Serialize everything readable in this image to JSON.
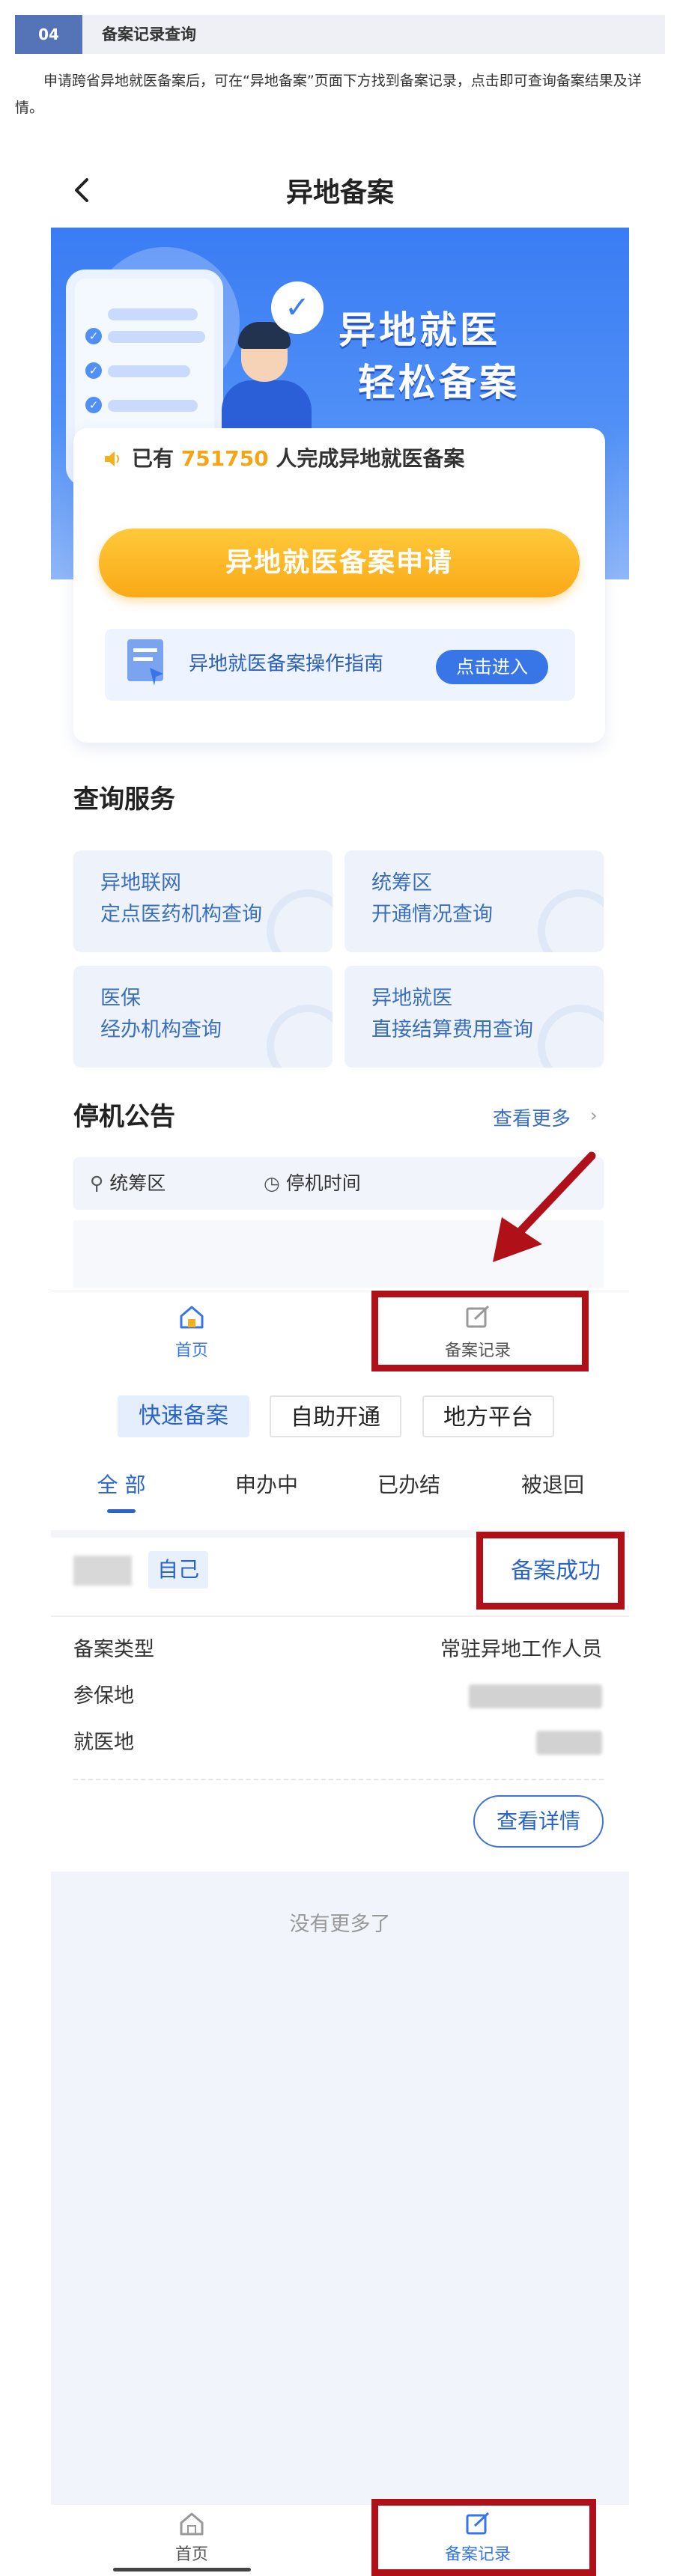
{
  "article": {
    "section_number": "04",
    "section_title": "备案记录查询",
    "intro": "申请跨省异地就医备案后，可在“异地备案”页面下方找到备案记录，点击即可查询备案结果及详情。"
  },
  "screen1": {
    "nav_title": "异地备案",
    "banner_line1": "异地就医",
    "banner_line2": "轻松备案",
    "stat_prefix": "已有",
    "stat_number": "751750",
    "stat_suffix": "人完成异地就医备案",
    "apply_button": "异地就医备案申请",
    "guide_text": "异地就医备案操作指南",
    "guide_button": "点击进入",
    "query_heading": "查询服务",
    "query_tiles": [
      {
        "line1": "异地联网",
        "line2": "定点医药机构查询"
      },
      {
        "line1": "统筹区",
        "line2": "开通情况查询"
      },
      {
        "line1": "医保",
        "line2": "经办机构查询"
      },
      {
        "line1": "异地就医",
        "line2": "直接结算费用查询"
      }
    ],
    "notice_heading": "停机公告",
    "notice_more": "查看更多",
    "notice_col1": "统筹区",
    "notice_col2": "停机时间",
    "tabbar": {
      "home": "首页",
      "records": "备案记录"
    }
  },
  "screen2": {
    "filter_chips": [
      "快速备案",
      "自助开通",
      "地方平台"
    ],
    "status_tabs": [
      "全 部",
      "申办中",
      "已办结",
      "被退回"
    ],
    "record": {
      "self_tag": "自己",
      "status": "备案成功",
      "rows": [
        {
          "label": "备案类型",
          "value": "常驻异地工作人员"
        },
        {
          "label": "参保地",
          "value": ""
        },
        {
          "label": "就医地",
          "value": ""
        }
      ],
      "detail_button": "查看详情"
    },
    "no_more": "没有更多了",
    "tabbar": {
      "home": "首页",
      "records": "备案记录"
    }
  },
  "colors": {
    "primary_blue": "#2b64c8",
    "highlight_red": "#b01119",
    "apply_orange": "#f9a916",
    "stat_number": "#f3a515"
  }
}
